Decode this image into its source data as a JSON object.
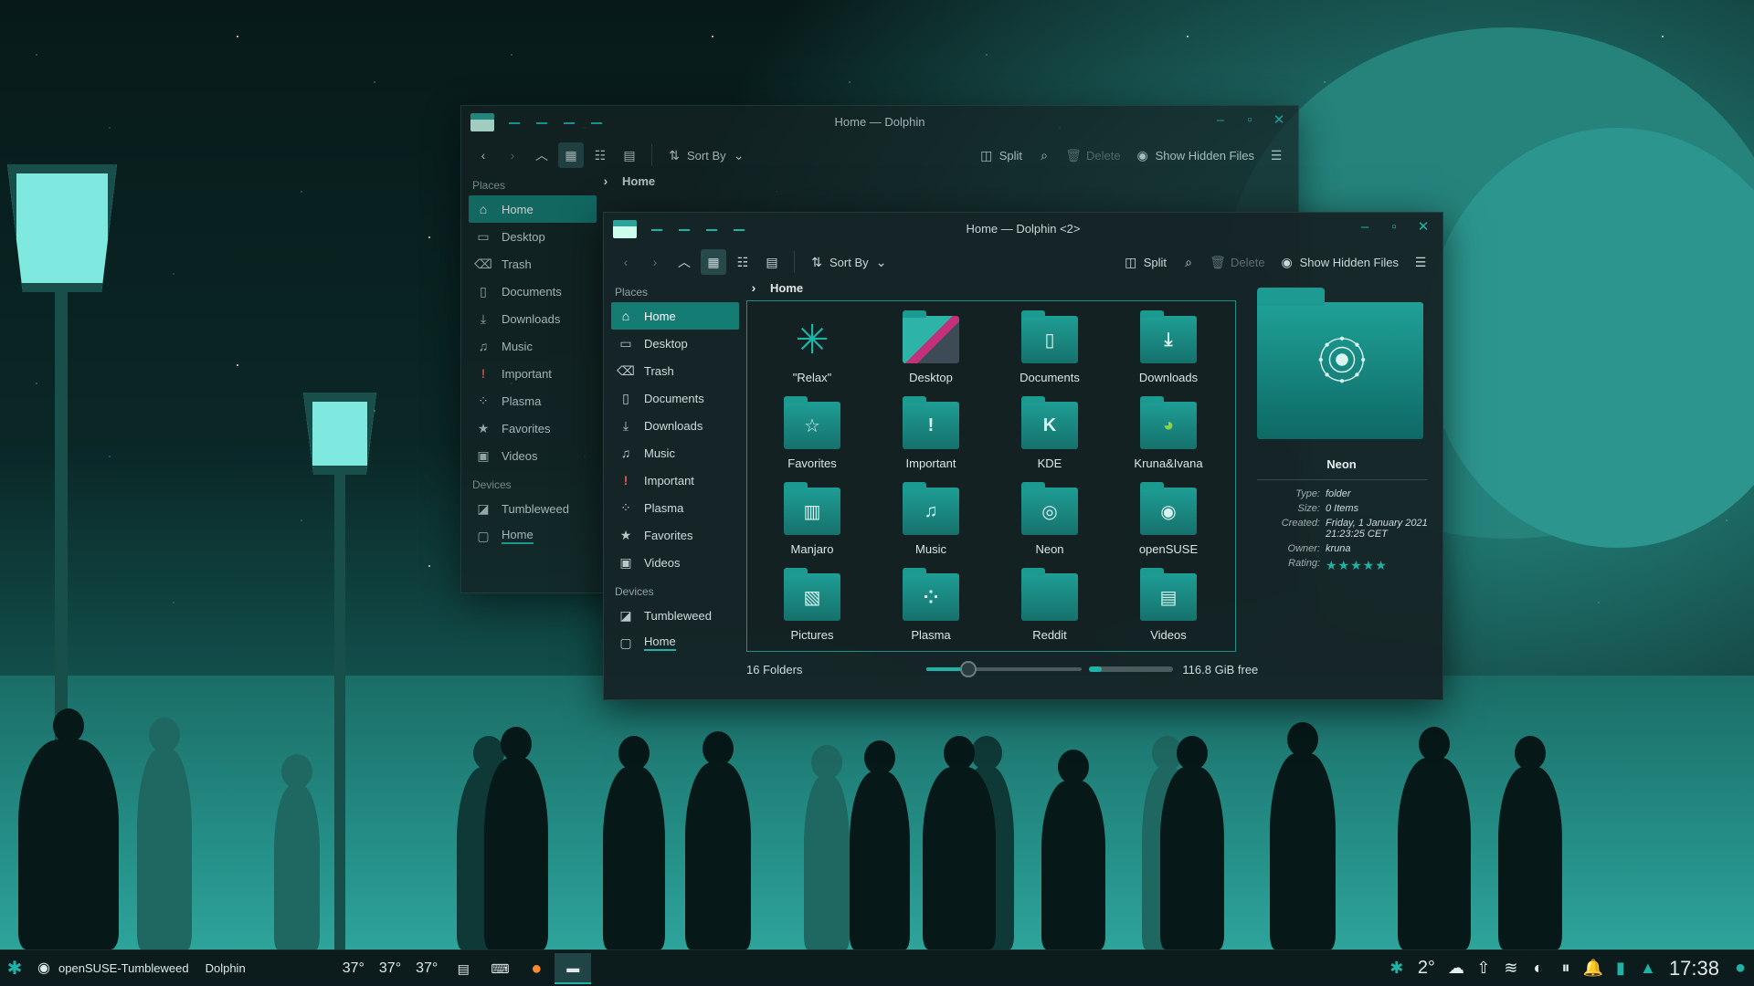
{
  "back_window": {
    "title": "Home — Dolphin",
    "toolbar": {
      "sort_by": "Sort By",
      "split": "Split",
      "delete": "Delete",
      "show_hidden": "Show Hidden Files"
    },
    "breadcrumb": "Home",
    "places_heading": "Places",
    "places": [
      "Home",
      "Desktop",
      "Trash",
      "Documents",
      "Downloads",
      "Music",
      "Important",
      "Plasma",
      "Favorites",
      "Videos"
    ],
    "devices_heading": "Devices",
    "devices": [
      "Tumbleweed",
      "Home"
    ]
  },
  "front_window": {
    "title": "Home — Dolphin <2>",
    "toolbar": {
      "sort_by": "Sort By",
      "split": "Split",
      "delete": "Delete",
      "show_hidden": "Show Hidden Files"
    },
    "breadcrumb": "Home",
    "places_heading": "Places",
    "places": [
      "Home",
      "Desktop",
      "Trash",
      "Documents",
      "Downloads",
      "Music",
      "Important",
      "Plasma",
      "Favorites",
      "Videos"
    ],
    "devices_heading": "Devices",
    "devices": [
      "Tumbleweed",
      "Home"
    ],
    "folders": [
      {
        "name": "\"Relax\"",
        "icon": "cannabis-leaf-icon"
      },
      {
        "name": "Desktop",
        "icon": "desktop-folder-icon"
      },
      {
        "name": "Documents",
        "icon": "document-icon"
      },
      {
        "name": "Downloads",
        "icon": "download-icon"
      },
      {
        "name": "Favorites",
        "icon": "star-icon"
      },
      {
        "name": "Important",
        "icon": "exclamation-icon"
      },
      {
        "name": "KDE",
        "icon": "kde-icon"
      },
      {
        "name": "Kruna&Ivana",
        "icon": "chameleon-icon"
      },
      {
        "name": "Manjaro",
        "icon": "manjaro-icon"
      },
      {
        "name": "Music",
        "icon": "music-note-icon"
      },
      {
        "name": "Neon",
        "icon": "neon-icon"
      },
      {
        "name": "openSUSE",
        "icon": "opensuse-icon"
      },
      {
        "name": "Pictures",
        "icon": "picture-icon"
      },
      {
        "name": "Plasma",
        "icon": "plasma-icon"
      },
      {
        "name": "Reddit",
        "icon": "folder-icon"
      },
      {
        "name": "Videos",
        "icon": "film-icon"
      }
    ],
    "status": {
      "count": "16 Folders",
      "zoom_fraction": 0.27,
      "disk_used_fraction": 0.15,
      "free_space": "116.8 GiB free"
    },
    "info": {
      "name": "Neon",
      "rows": [
        {
          "key": "Type:",
          "value": "folder"
        },
        {
          "key": "Size:",
          "value": "0 Items"
        },
        {
          "key": "Created:",
          "value": "Friday, 1 January 2021 21:23:25 CET"
        },
        {
          "key": "Owner:",
          "value": "kruna"
        },
        {
          "key": "Rating:",
          "value": "★★★★★"
        }
      ],
      "rating": 5
    }
  },
  "panel": {
    "activity": "openSUSE-Tumbleweed",
    "app_name": "Dolphin",
    "temps": [
      "37°",
      "37°",
      "37°"
    ],
    "weather_temp": "2°",
    "clock": "17:38"
  },
  "colors": {
    "accent": "#1fb3a7",
    "selection": "#157c74",
    "window_bg": "#162427"
  }
}
